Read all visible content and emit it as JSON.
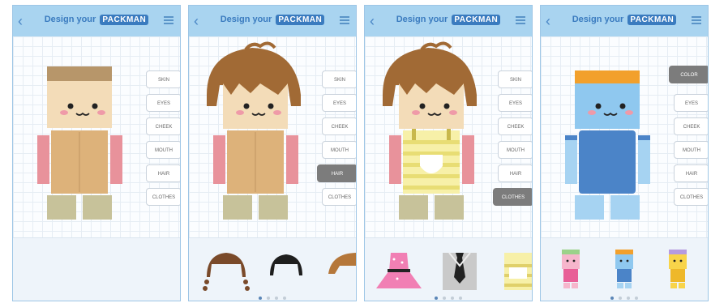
{
  "header": {
    "title_prefix": "Design your",
    "logo_text": "PACKMAN"
  },
  "screens": [
    {
      "options": [
        "SKIN",
        "EYES",
        "CHEEK",
        "MOUTH",
        "HAIR",
        "CLOTHES"
      ],
      "active_option": null
    },
    {
      "options": [
        "SKIN",
        "EYES",
        "CHEEK",
        "MOUTH",
        "HAIR",
        "CLOTHES"
      ],
      "active_option": "HAIR",
      "tray_items": [
        "pigtails-hair",
        "black-hair",
        "brown-hair"
      ]
    },
    {
      "options": [
        "SKIN",
        "EYES",
        "CHEEK",
        "MOUTH",
        "HAIR",
        "CLOTHES"
      ],
      "active_option": "CLOTHES",
      "tray_items": [
        "pink-dress",
        "suit-with-tie",
        "yellow-overalls"
      ]
    },
    {
      "options": [
        "COLOR",
        "EYES",
        "CHEEK",
        "MOUTH",
        "HAIR",
        "CLOTHES"
      ],
      "active_option": "COLOR",
      "tray_items": [
        "pink-packman",
        "blue-packman",
        "yellow-packman"
      ]
    }
  ],
  "colors": {
    "header_bg": "#a9d4f0",
    "accent": "#3a7bbf",
    "skin": "#f3dcb8",
    "body_tan": "#ddb27a",
    "arms_pink": "#e8929b",
    "legs": "#c7c29a",
    "hair_brown": "#a16a35",
    "blue_face": "#8fc8ef",
    "blue_body": "#4b84c8",
    "hat_orange": "#f2a02c"
  }
}
